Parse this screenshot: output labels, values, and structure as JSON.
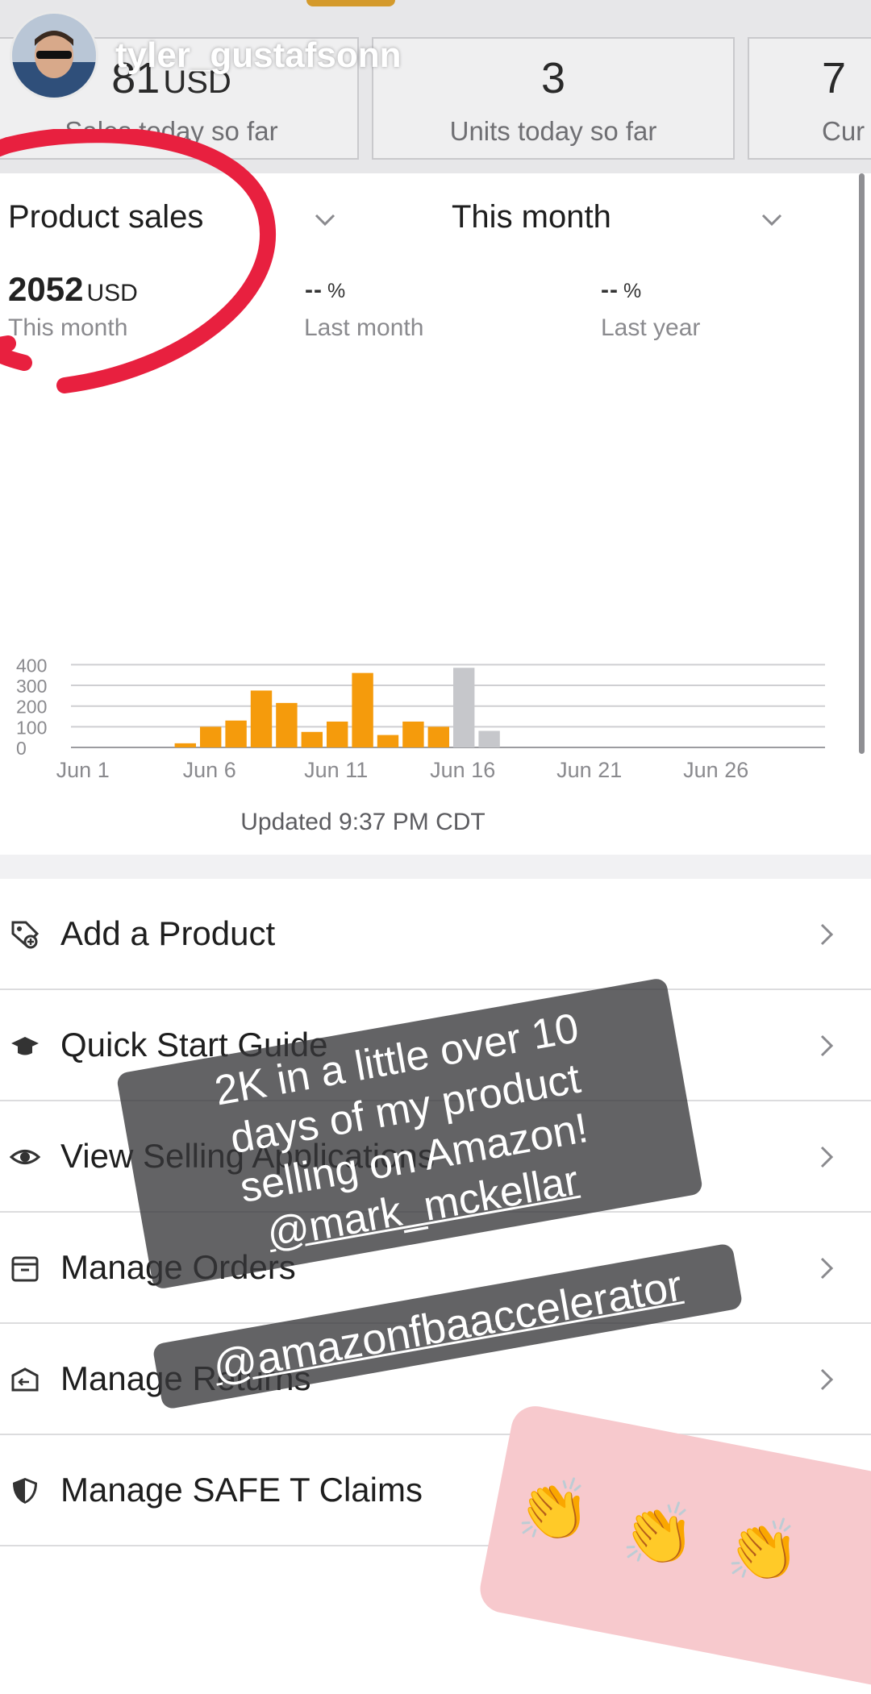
{
  "story": {
    "username": "tyler_gustafsonn",
    "overlay_text_lines": [
      "2K in a little over 10",
      "days of my product",
      "selling on Amazon!"
    ],
    "mention1": "@mark_mckellar",
    "mention2": "@amazonfbaaccelerator",
    "emoji": "👏"
  },
  "summary_cards": [
    {
      "value": "81",
      "unit": "USD",
      "caption": "Sales today so far"
    },
    {
      "value": "3",
      "caption": "Units today so far"
    },
    {
      "value": "7",
      "caption": "Cur"
    }
  ],
  "sales": {
    "metric_select": "Product sales",
    "period_select": "This month",
    "this_month_value": "2052",
    "this_month_unit": "USD",
    "this_month_caption": "This month",
    "last_month_value": "--",
    "last_month_unit": "%",
    "last_month_caption": "Last month",
    "last_year_value": "--",
    "last_year_unit": "%",
    "last_year_caption": "Last year",
    "updated": "Updated 9:37 PM CDT"
  },
  "chart_data": {
    "type": "bar",
    "x_tick_labels": [
      "Jun 1",
      "Jun 6",
      "Jun 11",
      "Jun 16",
      "Jun 21",
      "Jun 26"
    ],
    "y_tick_labels": [
      "0",
      "100",
      "200",
      "300",
      "400"
    ],
    "ylim": [
      0,
      400
    ],
    "series": [
      {
        "colour": "#f59b0c",
        "days": [
          5,
          6,
          7,
          8,
          9,
          10,
          11,
          12,
          13,
          14,
          15,
          16
        ],
        "values": [
          20,
          100,
          130,
          275,
          215,
          75,
          125,
          360,
          60,
          125,
          100,
          0
        ]
      },
      {
        "colour": "#c6c7cb",
        "days": [
          16,
          17
        ],
        "values": [
          385,
          80
        ]
      }
    ],
    "grid": true
  },
  "menu": [
    {
      "label": "Add a Product",
      "icon": "tag-add-icon"
    },
    {
      "label": "Quick Start Guide",
      "icon": "graduation-cap-icon"
    },
    {
      "label": "View Selling Applications",
      "icon": "eye-icon"
    },
    {
      "label": "Manage Orders",
      "icon": "archive-box-icon"
    },
    {
      "label": "Manage Returns",
      "icon": "return-box-icon"
    },
    {
      "label": "Manage SAFE T Claims",
      "icon": "shield-icon"
    }
  ]
}
